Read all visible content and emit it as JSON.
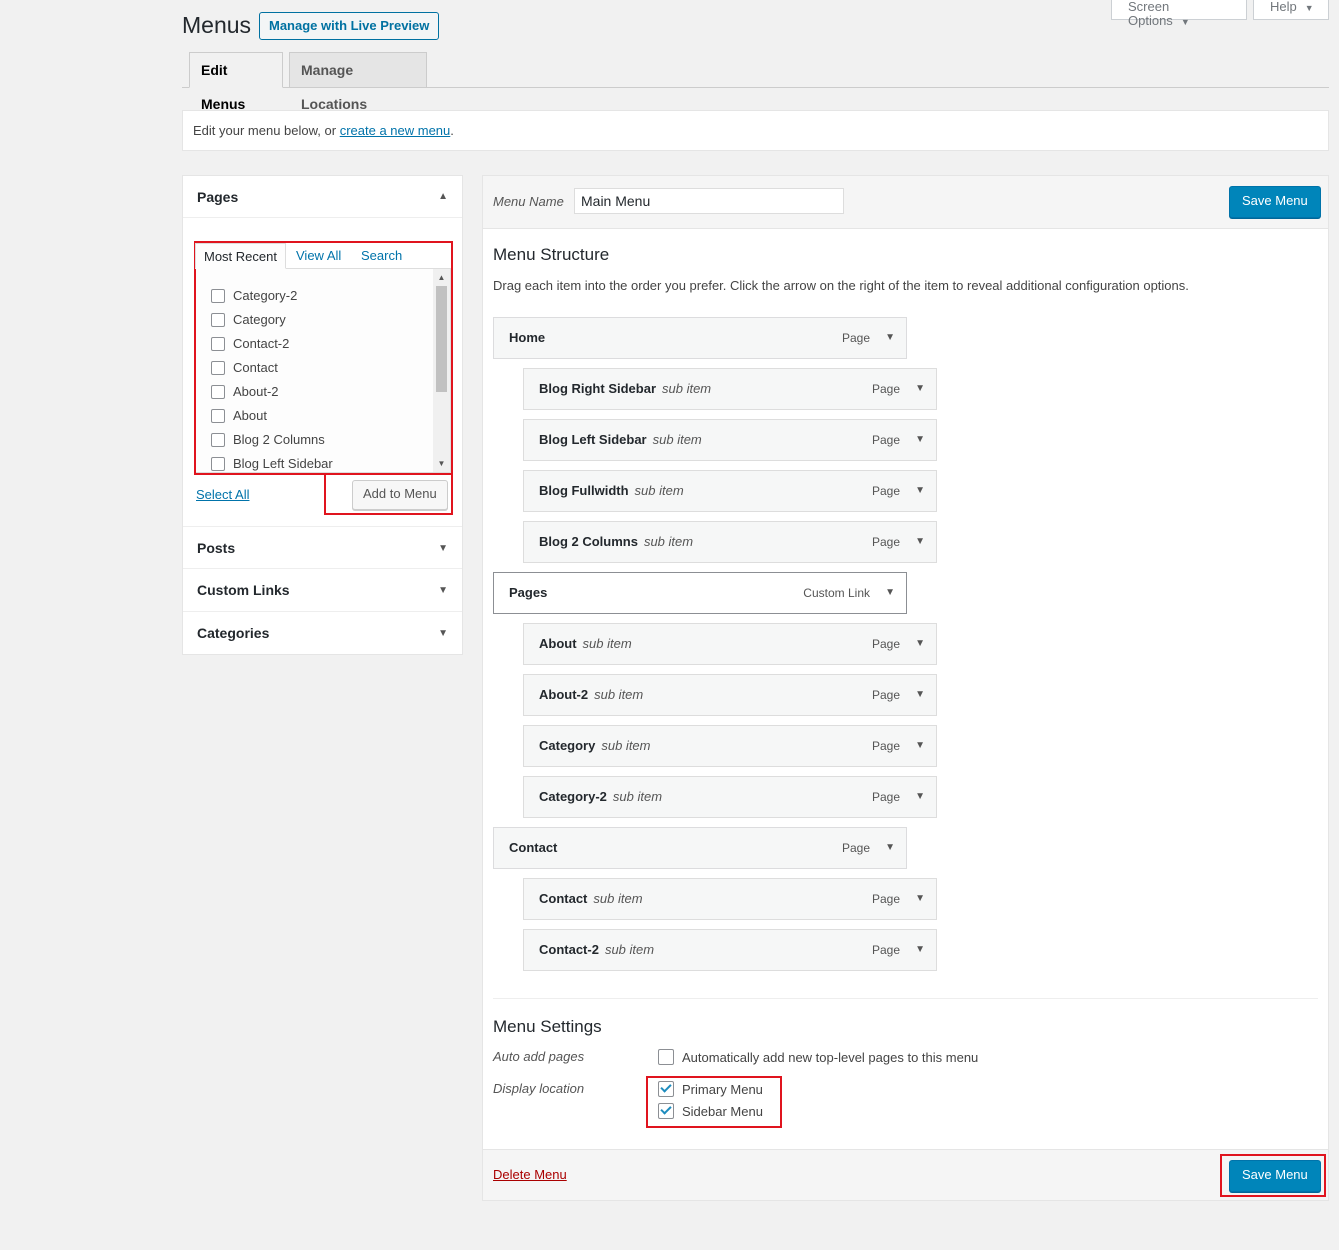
{
  "screen_meta": {
    "screen_options": "Screen Options",
    "help": "Help"
  },
  "title": "Menus",
  "live_preview": "Manage with Live Preview",
  "tabs": [
    {
      "label": "Edit Menus",
      "active": true
    },
    {
      "label": "Manage Locations",
      "active": false
    }
  ],
  "info": {
    "text": "Edit your menu below, or ",
    "link": "create a new menu",
    "end": "."
  },
  "sidebar": {
    "pages": {
      "title": "Pages",
      "tabs": [
        "Most Recent",
        "View All",
        "Search"
      ],
      "items": [
        "Category-2",
        "Category",
        "Contact-2",
        "Contact",
        "About-2",
        "About",
        "Blog 2 Columns",
        "Blog Left Sidebar"
      ],
      "select_all": "Select All",
      "add_to_menu": "Add to Menu"
    },
    "sections": [
      "Posts",
      "Custom Links",
      "Categories"
    ]
  },
  "edit": {
    "menu_name_label": "Menu Name",
    "menu_name_value": "Main Menu",
    "save_label": "Save Menu",
    "structure_title": "Menu Structure",
    "structure_desc": "Drag each item into the order you prefer. Click the arrow on the right of the item to reveal additional configuration options.",
    "items": [
      {
        "title": "Home",
        "sub": "",
        "type": "Page",
        "depth": 0
      },
      {
        "title": "Blog Right Sidebar",
        "sub": "sub item",
        "type": "Page",
        "depth": 1
      },
      {
        "title": "Blog Left Sidebar",
        "sub": "sub item",
        "type": "Page",
        "depth": 1
      },
      {
        "title": "Blog Fullwidth",
        "sub": "sub item",
        "type": "Page",
        "depth": 1
      },
      {
        "title": "Blog 2 Columns",
        "sub": "sub item",
        "type": "Page",
        "depth": 1
      },
      {
        "title": "Pages",
        "sub": "",
        "type": "Custom Link",
        "depth": 0
      },
      {
        "title": "About",
        "sub": "sub item",
        "type": "Page",
        "depth": 1
      },
      {
        "title": "About-2",
        "sub": "sub item",
        "type": "Page",
        "depth": 1
      },
      {
        "title": "Category",
        "sub": "sub item",
        "type": "Page",
        "depth": 1
      },
      {
        "title": "Category-2",
        "sub": "sub item",
        "type": "Page",
        "depth": 1
      },
      {
        "title": "Contact",
        "sub": "",
        "type": "Page",
        "depth": 0
      },
      {
        "title": "Contact",
        "sub": "sub item",
        "type": "Page",
        "depth": 1
      },
      {
        "title": "Contact-2",
        "sub": "sub item",
        "type": "Page",
        "depth": 1
      }
    ],
    "settings_title": "Menu Settings",
    "auto_add_label": "Auto add pages",
    "auto_add_text": "Automatically add new top-level pages to this menu",
    "auto_add_checked": false,
    "display_location_label": "Display location",
    "locations": [
      {
        "label": "Primary Menu",
        "checked": true
      },
      {
        "label": "Sidebar Menu",
        "checked": true
      }
    ],
    "delete_label": "Delete Menu"
  },
  "colors": {
    "accent": "#0085ba",
    "link": "#0073aa",
    "delete": "#a00",
    "highlight": "#e0141e"
  }
}
